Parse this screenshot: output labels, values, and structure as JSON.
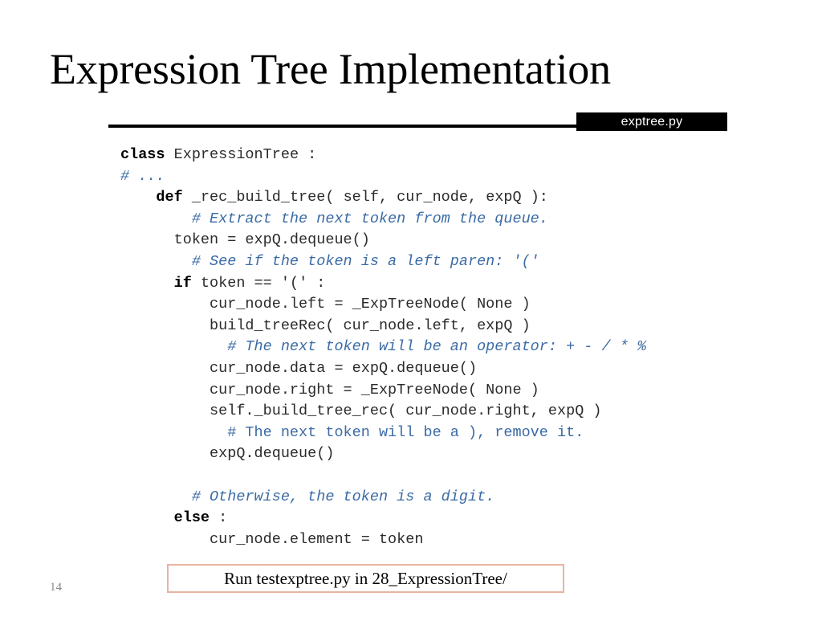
{
  "slide": {
    "title": "Expression Tree Implementation",
    "page_number": "14",
    "file_banner": "exptree.py",
    "run_instruction": "Run testexptree.py in 28_ExpressionTree/",
    "colors": {
      "comment": "#3b6ba5",
      "code": "#2b2b2b",
      "keyword": "#000000",
      "banner_bg": "#000000",
      "banner_text": "#ffffff",
      "run_box_border": "#e8b4a0",
      "page_number": "#8a8a8a"
    }
  },
  "code": {
    "lines": [
      {
        "indent": 0,
        "kw": "class",
        "rest": " ExpressionTree :"
      },
      {
        "indent": 0,
        "comment": "# ..."
      },
      {
        "indent": 2,
        "kw": "def",
        "rest": " _rec_build_tree( self, cur_node, expQ ):"
      },
      {
        "indent": 4,
        "comment": "# Extract the next token from the queue."
      },
      {
        "indent": 3,
        "plain": "token = expQ.dequeue()"
      },
      {
        "indent": 4,
        "comment": "# See if the token is a left paren: '('"
      },
      {
        "indent": 3,
        "kw": "if",
        "rest": " token == '(' :"
      },
      {
        "indent": 5,
        "plain": "cur_node.left = _ExpTreeNode( None )"
      },
      {
        "indent": 5,
        "plain": "build_treeRec( cur_node.left, expQ )"
      },
      {
        "indent": 6,
        "comment": "# The next token will be an operator: + - / * %"
      },
      {
        "indent": 5,
        "plain": "cur_node.data = expQ.dequeue()"
      },
      {
        "indent": 5,
        "plain": "cur_node.right = _ExpTreeNode( None )"
      },
      {
        "indent": 5,
        "plain": "self._build_tree_rec( cur_node.right, expQ )"
      },
      {
        "indent": 6,
        "comment_upright": "# The next token will be a ), remove it."
      },
      {
        "indent": 5,
        "plain": "expQ.dequeue()"
      },
      {
        "blank": true
      },
      {
        "indent": 4,
        "comment": "# Otherwise, the token is a digit."
      },
      {
        "indent": 3,
        "kw": "else",
        "rest": " :"
      },
      {
        "indent": 5,
        "plain": "cur_node.element = token"
      }
    ]
  }
}
